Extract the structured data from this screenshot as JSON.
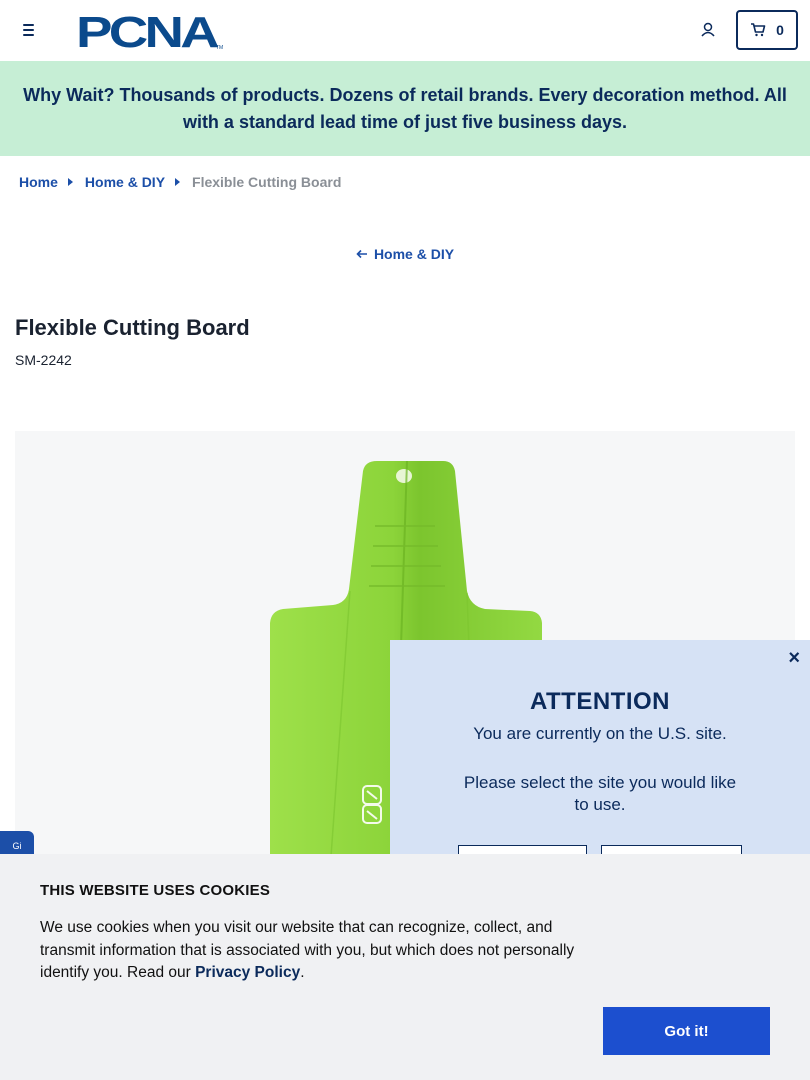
{
  "header": {
    "logo_text": "PCNA",
    "logo_mark": "TM",
    "cart_count": "0"
  },
  "promo": {
    "text": "Why Wait? Thousands of products. Dozens of retail brands. Every decoration method. All with a standard lead time of just five business days."
  },
  "breadcrumb": {
    "items": [
      "Home",
      "Home & DIY"
    ],
    "current": "Flexible Cutting Board"
  },
  "back_link": {
    "label": "Home & DIY"
  },
  "product": {
    "title": "Flexible Cutting Board",
    "sku": "SM-2242",
    "color": "#8fd63a"
  },
  "side_tab": {
    "label": "Gi"
  },
  "attention": {
    "title": "ATTENTION",
    "line1": "You are currently on the U.S. site.",
    "line2": "Please select the site you would like to use.",
    "close": "×"
  },
  "cookie": {
    "title": "THIS WEBSITE USES COOKIES",
    "text": "We use cookies when you visit our website that can recognize, collect, and transmit information that is associated with you, but which does not personally identify you. Read our ",
    "link": "Privacy Policy",
    "suffix": ".",
    "button": "Got it!"
  },
  "colors": {
    "brand_navy": "#0b2a5b",
    "link_blue": "#1c4fa8",
    "promo_bg": "#c6eed5",
    "modal_bg": "#d6e2f5",
    "button_blue": "#1c4fcf"
  },
  "icons": [
    "menu-icon",
    "account-icon",
    "cart-icon",
    "arrow-left-icon",
    "caret-right-icon",
    "close-icon"
  ]
}
